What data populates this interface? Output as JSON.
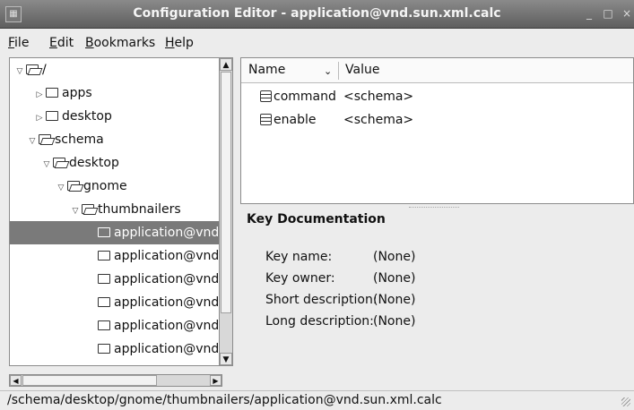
{
  "window": {
    "title": "Configuration Editor - application@vnd.sun.xml.calc",
    "minimize": "_",
    "maximize": "□",
    "close": "×"
  },
  "menubar": {
    "file": {
      "mnemonic": "F",
      "rest": "ile"
    },
    "edit": {
      "mnemonic": "E",
      "rest": "dit"
    },
    "bookmarks": {
      "mnemonic": "B",
      "rest": "ookmarks"
    },
    "help": {
      "mnemonic": "H",
      "rest": "elp"
    }
  },
  "tree": {
    "rows": [
      {
        "label": "/",
        "expander": "▽",
        "open": true
      },
      {
        "label": "apps",
        "expander": "▷",
        "open": false
      },
      {
        "label": "desktop",
        "expander": "▷",
        "open": false
      },
      {
        "label": "schema",
        "expander": "▽",
        "open": true
      },
      {
        "label": "desktop",
        "expander": "▽",
        "open": true
      },
      {
        "label": "gnome",
        "expander": "▽",
        "open": true
      },
      {
        "label": "thumbnailers",
        "expander": "▽",
        "open": true
      },
      {
        "label": "application@vnd.",
        "expander": "",
        "open": false,
        "selected": true
      },
      {
        "label": "application@vnd.",
        "expander": "",
        "open": false
      },
      {
        "label": "application@vnd.",
        "expander": "",
        "open": false
      },
      {
        "label": "application@vnd.",
        "expander": "",
        "open": false
      },
      {
        "label": "application@vnd.",
        "expander": "",
        "open": false
      },
      {
        "label": "application@vnd.",
        "expander": "",
        "open": false
      }
    ]
  },
  "list": {
    "columns": {
      "name": "Name",
      "sort_indicator": "⌄",
      "value": "Value"
    },
    "rows": [
      {
        "name": "command",
        "value": "<schema>"
      },
      {
        "name": "enable",
        "value": "<schema>"
      }
    ]
  },
  "documentation": {
    "title": "Key Documentation",
    "fields": [
      {
        "label": "Key name:",
        "value": "(None)"
      },
      {
        "label": "Key owner:",
        "value": "(None)"
      },
      {
        "label": "Short description:",
        "value": "(None)"
      },
      {
        "label": "Long description:",
        "value": "(None)"
      }
    ]
  },
  "statusbar": {
    "path": "/schema/desktop/gnome/thumbnailers/application@vnd.sun.xml.calc"
  },
  "colors": {
    "titlebar": "#6f6f6f",
    "selection": "#7a7a7a"
  }
}
